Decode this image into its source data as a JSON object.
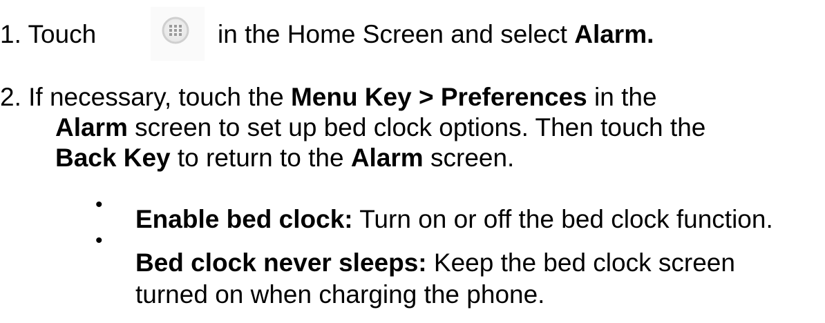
{
  "step1": {
    "prefix": "1. Touch ",
    "icon": "apps-grid-icon",
    "after_icon": "in the Home Screen and select ",
    "target": "Alarm."
  },
  "step2": {
    "line1_prefix": "2. If necessary, touch the ",
    "line1_bold": "Menu Key > Preferences",
    "line1_suffix": " in the",
    "line2_bold": "Alarm",
    "line2_suffix": " screen to set up bed clock options. Then touch the",
    "line3_bold1": "Back Key",
    "line3_mid": " to return to the ",
    "line3_bold2": "Alarm",
    "line3_suffix": " screen."
  },
  "options": [
    {
      "bullet": "•",
      "label": "Enable bed clock:",
      "description": " Turn on or off the bed clock function."
    },
    {
      "bullet": "•",
      "label": "Bed clock never sleeps:",
      "description": " Keep the bed clock screen",
      "description_cont": "turned on when charging the phone."
    }
  ]
}
